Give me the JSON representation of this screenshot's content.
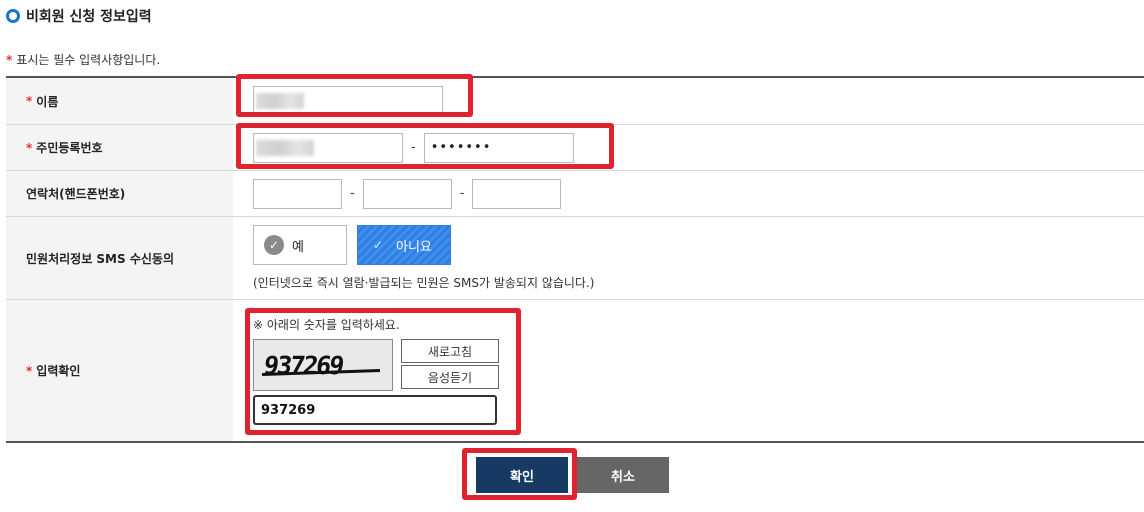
{
  "section": {
    "title": "비회원 신청 정보입력"
  },
  "required_note": {
    "star": "*",
    "text": "표시는 필수 입력사항입니다."
  },
  "fields": {
    "name": {
      "star": "*",
      "label": "이름"
    },
    "rrn": {
      "star": "*",
      "label": "주민등록번호",
      "separator": "-",
      "back_value": "•••••••"
    },
    "phone": {
      "label": "연락처(핸드폰번호)",
      "separator": "-"
    },
    "sms": {
      "label": "민원처리정보 SMS 수신동의",
      "yes_label": "예",
      "no_label": "아니요",
      "selected": "아니요",
      "note": "(인터넷으로 즉시 열람·발급되는 민원은 SMS가 발송되지 않습니다.)"
    },
    "captcha": {
      "star": "*",
      "label": "입력확인",
      "hint": "※ 아래의 숫자를 입력하세요.",
      "image_text": "937269",
      "refresh_label": "새로고침",
      "audio_label": "음성듣기",
      "input_value": "937269"
    }
  },
  "actions": {
    "confirm_label": "확인",
    "cancel_label": "취소"
  },
  "colors": {
    "highlight": "#e0242f",
    "confirm_bg": "#163a63",
    "cancel_bg": "#666666",
    "selected_bg": "#2f7fe0",
    "required": "#e0313c"
  }
}
